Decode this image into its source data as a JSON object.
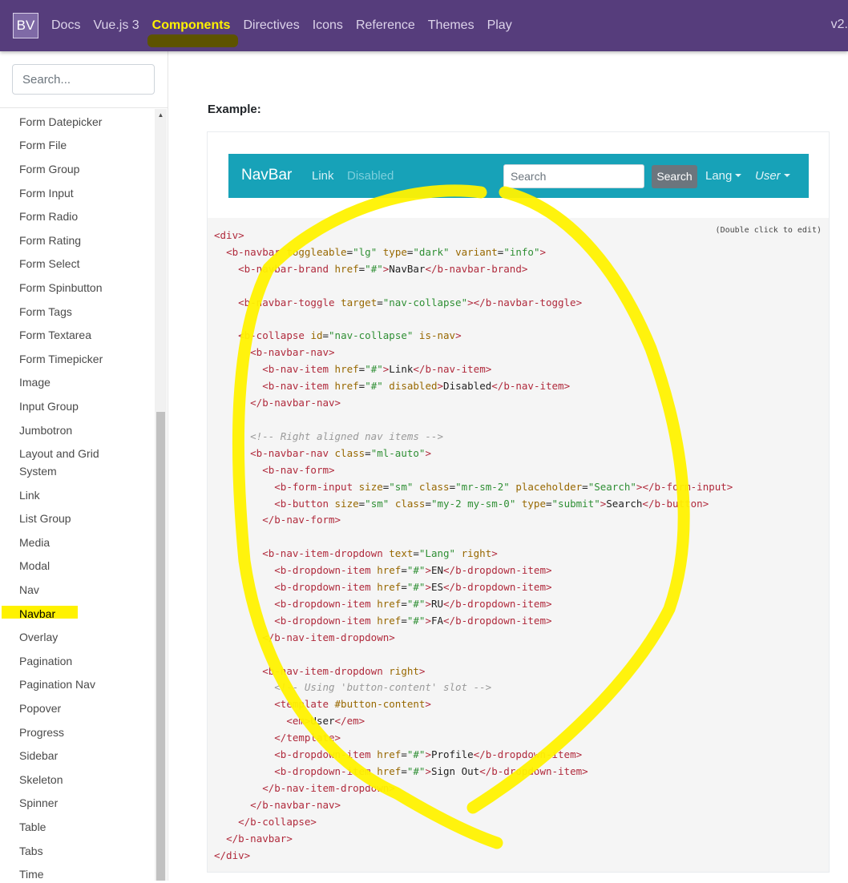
{
  "topnav": {
    "brand": "BV",
    "links": [
      "Docs",
      "Vue.js 3",
      "Components",
      "Directives",
      "Icons",
      "Reference",
      "Themes",
      "Play"
    ],
    "active": "Components",
    "version": "v2."
  },
  "sidebar": {
    "search_placeholder": "Search...",
    "items": [
      "Form Datepicker",
      "Form File",
      "Form Group",
      "Form Input",
      "Form Radio",
      "Form Rating",
      "Form Select",
      "Form Spinbutton",
      "Form Tags",
      "Form Textarea",
      "Form Timepicker",
      "Image",
      "Input Group",
      "Jumbotron",
      "Layout and Grid",
      "System",
      "Link",
      "List Group",
      "Media",
      "Modal",
      "Nav",
      "Navbar",
      "Overlay",
      "Pagination",
      "Pagination Nav",
      "Popover",
      "Progress",
      "Sidebar",
      "Skeleton",
      "Spinner",
      "Table",
      "Tabs",
      "Time"
    ],
    "active": "Navbar"
  },
  "main": {
    "example_label": "Example:",
    "double_click_hint": "(Double click to edit)"
  },
  "demo_navbar": {
    "brand": "NavBar",
    "link": "Link",
    "disabled": "Disabled",
    "search_placeholder": "Search",
    "search_button": "Search",
    "lang": "Lang",
    "user": "User"
  },
  "colors": {
    "topbar": "#563d7c",
    "demo_navbar": "#17a2b8",
    "highlight": "#fff200"
  },
  "code_lines": [
    "<div>",
    "  <b-navbar toggleable=\"lg\" type=\"dark\" variant=\"info\">",
    "    <b-navbar-brand href=\"#\">NavBar</b-navbar-brand>",
    "",
    "    <b-navbar-toggle target=\"nav-collapse\"></b-navbar-toggle>",
    "",
    "    <b-collapse id=\"nav-collapse\" is-nav>",
    "      <b-navbar-nav>",
    "        <b-nav-item href=\"#\">Link</b-nav-item>",
    "        <b-nav-item href=\"#\" disabled>Disabled</b-nav-item>",
    "      </b-navbar-nav>",
    "",
    "      <!-- Right aligned nav items -->",
    "      <b-navbar-nav class=\"ml-auto\">",
    "        <b-nav-form>",
    "          <b-form-input size=\"sm\" class=\"mr-sm-2\" placeholder=\"Search\"></b-form-input>",
    "          <b-button size=\"sm\" class=\"my-2 my-sm-0\" type=\"submit\">Search</b-button>",
    "        </b-nav-form>",
    "",
    "        <b-nav-item-dropdown text=\"Lang\" right>",
    "          <b-dropdown-item href=\"#\">EN</b-dropdown-item>",
    "          <b-dropdown-item href=\"#\">ES</b-dropdown-item>",
    "          <b-dropdown-item href=\"#\">RU</b-dropdown-item>",
    "          <b-dropdown-item href=\"#\">FA</b-dropdown-item>",
    "        </b-nav-item-dropdown>",
    "",
    "        <b-nav-item-dropdown right>",
    "          <!-- Using 'button-content' slot -->",
    "          <template #button-content>",
    "            <em>User</em>",
    "          </template>",
    "          <b-dropdown-item href=\"#\">Profile</b-dropdown-item>",
    "          <b-dropdown-item href=\"#\">Sign Out</b-dropdown-item>",
    "        </b-nav-item-dropdown>",
    "      </b-navbar-nav>",
    "    </b-collapse>",
    "  </b-navbar>",
    "</div>"
  ]
}
